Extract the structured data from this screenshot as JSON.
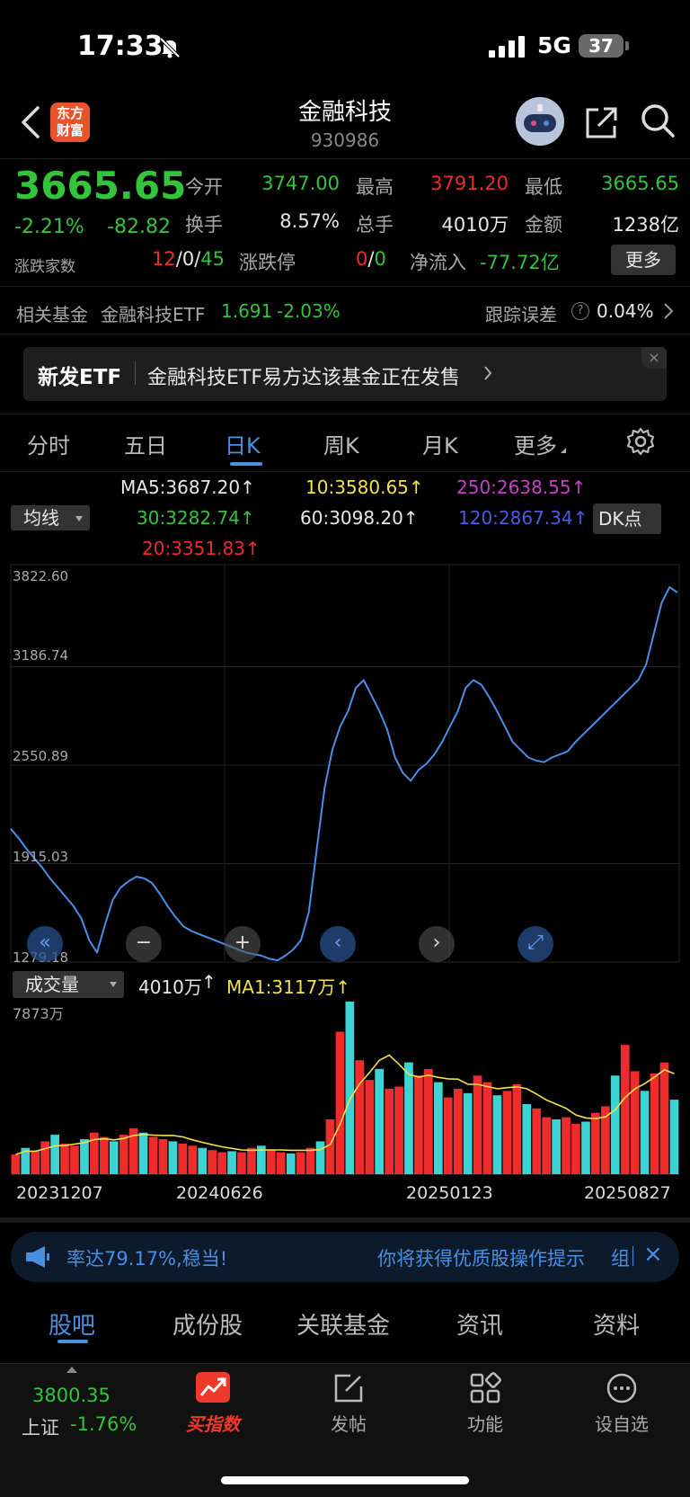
{
  "status": {
    "time": "17:33",
    "network": "5G",
    "battery": "37"
  },
  "header": {
    "logo_line1": "东方",
    "logo_line2": "财富",
    "title": "金融科技",
    "code": "930986"
  },
  "quote": {
    "price": "3665.65",
    "change_pct": "-2.21%",
    "change": "-82.82",
    "open_label": "今开",
    "open": "3747.00",
    "high_label": "最高",
    "high": "3791.20",
    "low_label": "最低",
    "low": "3665.65",
    "turnover_label": "换手",
    "turnover": "8.57%",
    "volume_label": "总手",
    "volume": "4010万",
    "amount_label": "金额",
    "amount": "1238亿",
    "breadth_label": "涨跌家数",
    "breadth_up": "12",
    "breadth_flat": "0",
    "breadth_down": "45",
    "slash": "/",
    "limit_label": "涨跌停",
    "limit_up": "0",
    "limit_down": "0",
    "inflow_label": "净流入",
    "inflow": "-77.72亿",
    "more": "更多"
  },
  "fund": {
    "label": "相关基金",
    "name": "金融科技ETF",
    "price": "1.691",
    "change": "-2.03%",
    "track_label": "跟踪误差",
    "track": "0.04%"
  },
  "banner": {
    "tag": "新发ETF",
    "text": "金融科技ETF易方达该基金正在发售",
    "close": "×"
  },
  "tabs": [
    "分时",
    "五日",
    "日K",
    "周K",
    "月K",
    "更多"
  ],
  "ma": {
    "dropdown": "均线",
    "dk": "DK点",
    "ma5": "MA5:3687.20↑",
    "ma10": "10:3580.65↑",
    "ma250": "250:2638.55↑",
    "ma30": "30:3282.74↑",
    "ma60": "60:3098.20↑",
    "ma120": "120:2867.34↑",
    "ma20": "20:3351.83↑"
  },
  "colors": {
    "up": "#ee2c2c",
    "down": "#33c43c",
    "accent": "#4a90e2",
    "price_line": "#4a8ee8",
    "ma_vol": "#f2e24a",
    "vol_up": "#ee2c2c",
    "vol_down": "#3ed3d3"
  },
  "chart_data": [
    {
      "type": "line",
      "ylim": [
        1279.18,
        3822.6
      ],
      "y_ticks": [
        "3822.60",
        "3186.74",
        "2550.89",
        "1915.03",
        "1279.18"
      ],
      "x_ticks": [
        "20231207",
        "20240626",
        "20250123",
        "20250827"
      ],
      "series": [
        {
          "values": [
            2140,
            2080,
            2010,
            1950,
            1890,
            1820,
            1760,
            1700,
            1640,
            1560,
            1420,
            1340,
            1520,
            1680,
            1760,
            1800,
            1830,
            1820,
            1790,
            1720,
            1640,
            1570,
            1510,
            1480,
            1460,
            1440,
            1420,
            1400,
            1380,
            1360,
            1340,
            1330,
            1320,
            1300,
            1290,
            1320,
            1360,
            1420,
            1600,
            2000,
            2400,
            2650,
            2800,
            2900,
            3050,
            3100,
            3000,
            2900,
            2780,
            2600,
            2500,
            2450,
            2520,
            2560,
            2620,
            2700,
            2800,
            2900,
            3050,
            3100,
            3070,
            2990,
            2900,
            2800,
            2700,
            2650,
            2600,
            2580,
            2570,
            2600,
            2620,
            2640,
            2700,
            2750,
            2800,
            2850,
            2900,
            2950,
            3000,
            3050,
            3100,
            3200,
            3400,
            3600,
            3700,
            3665.65
          ]
        }
      ]
    },
    {
      "type": "bar",
      "title": "成交量",
      "volume": "4010万",
      "ma1": "MA1:3117万↑",
      "ylim": [
        0,
        7873
      ],
      "y_max_label": "7873万",
      "series": [
        {
          "values": [
            900,
            1200,
            1050,
            1500,
            1800,
            1400,
            1300,
            1600,
            1900,
            1700,
            1500,
            1800,
            2100,
            1900,
            1700,
            1600,
            1500,
            1400,
            1300,
            1200,
            1100,
            1000,
            1050,
            1000,
            1200,
            1300,
            1100,
            1000,
            950,
            1000,
            1200,
            1500,
            2500,
            6500,
            7873,
            5200,
            4300,
            4800,
            3900,
            4000,
            5100,
            4500,
            4800,
            4200,
            3500,
            3900,
            3700,
            4500,
            4200,
            3600,
            3800,
            4100,
            3200,
            3000,
            2600,
            2500,
            2600,
            2300,
            2400,
            2800,
            3100,
            4500,
            5900,
            4700,
            3800,
            4600,
            5100,
            3400
          ]
        }
      ]
    }
  ],
  "controls": {
    "prev_page": "«",
    "zoom_out": "−",
    "zoom_in": "+",
    "left": "‹",
    "right": "›",
    "fullscreen": "⤢"
  },
  "ticker": {
    "text1": "率达79.17%,稳当!",
    "text2": "你将获得优质股操作提示",
    "text3": "组",
    "close": "×"
  },
  "bottom_tabs": [
    "股吧",
    "成份股",
    "关联基金",
    "资讯",
    "资料"
  ],
  "nav": {
    "index_value": "3800.35",
    "index_name": "上证",
    "index_change": "-1.76%",
    "buy": "买指数",
    "post": "发帖",
    "func": "功能",
    "watch": "设自选"
  }
}
